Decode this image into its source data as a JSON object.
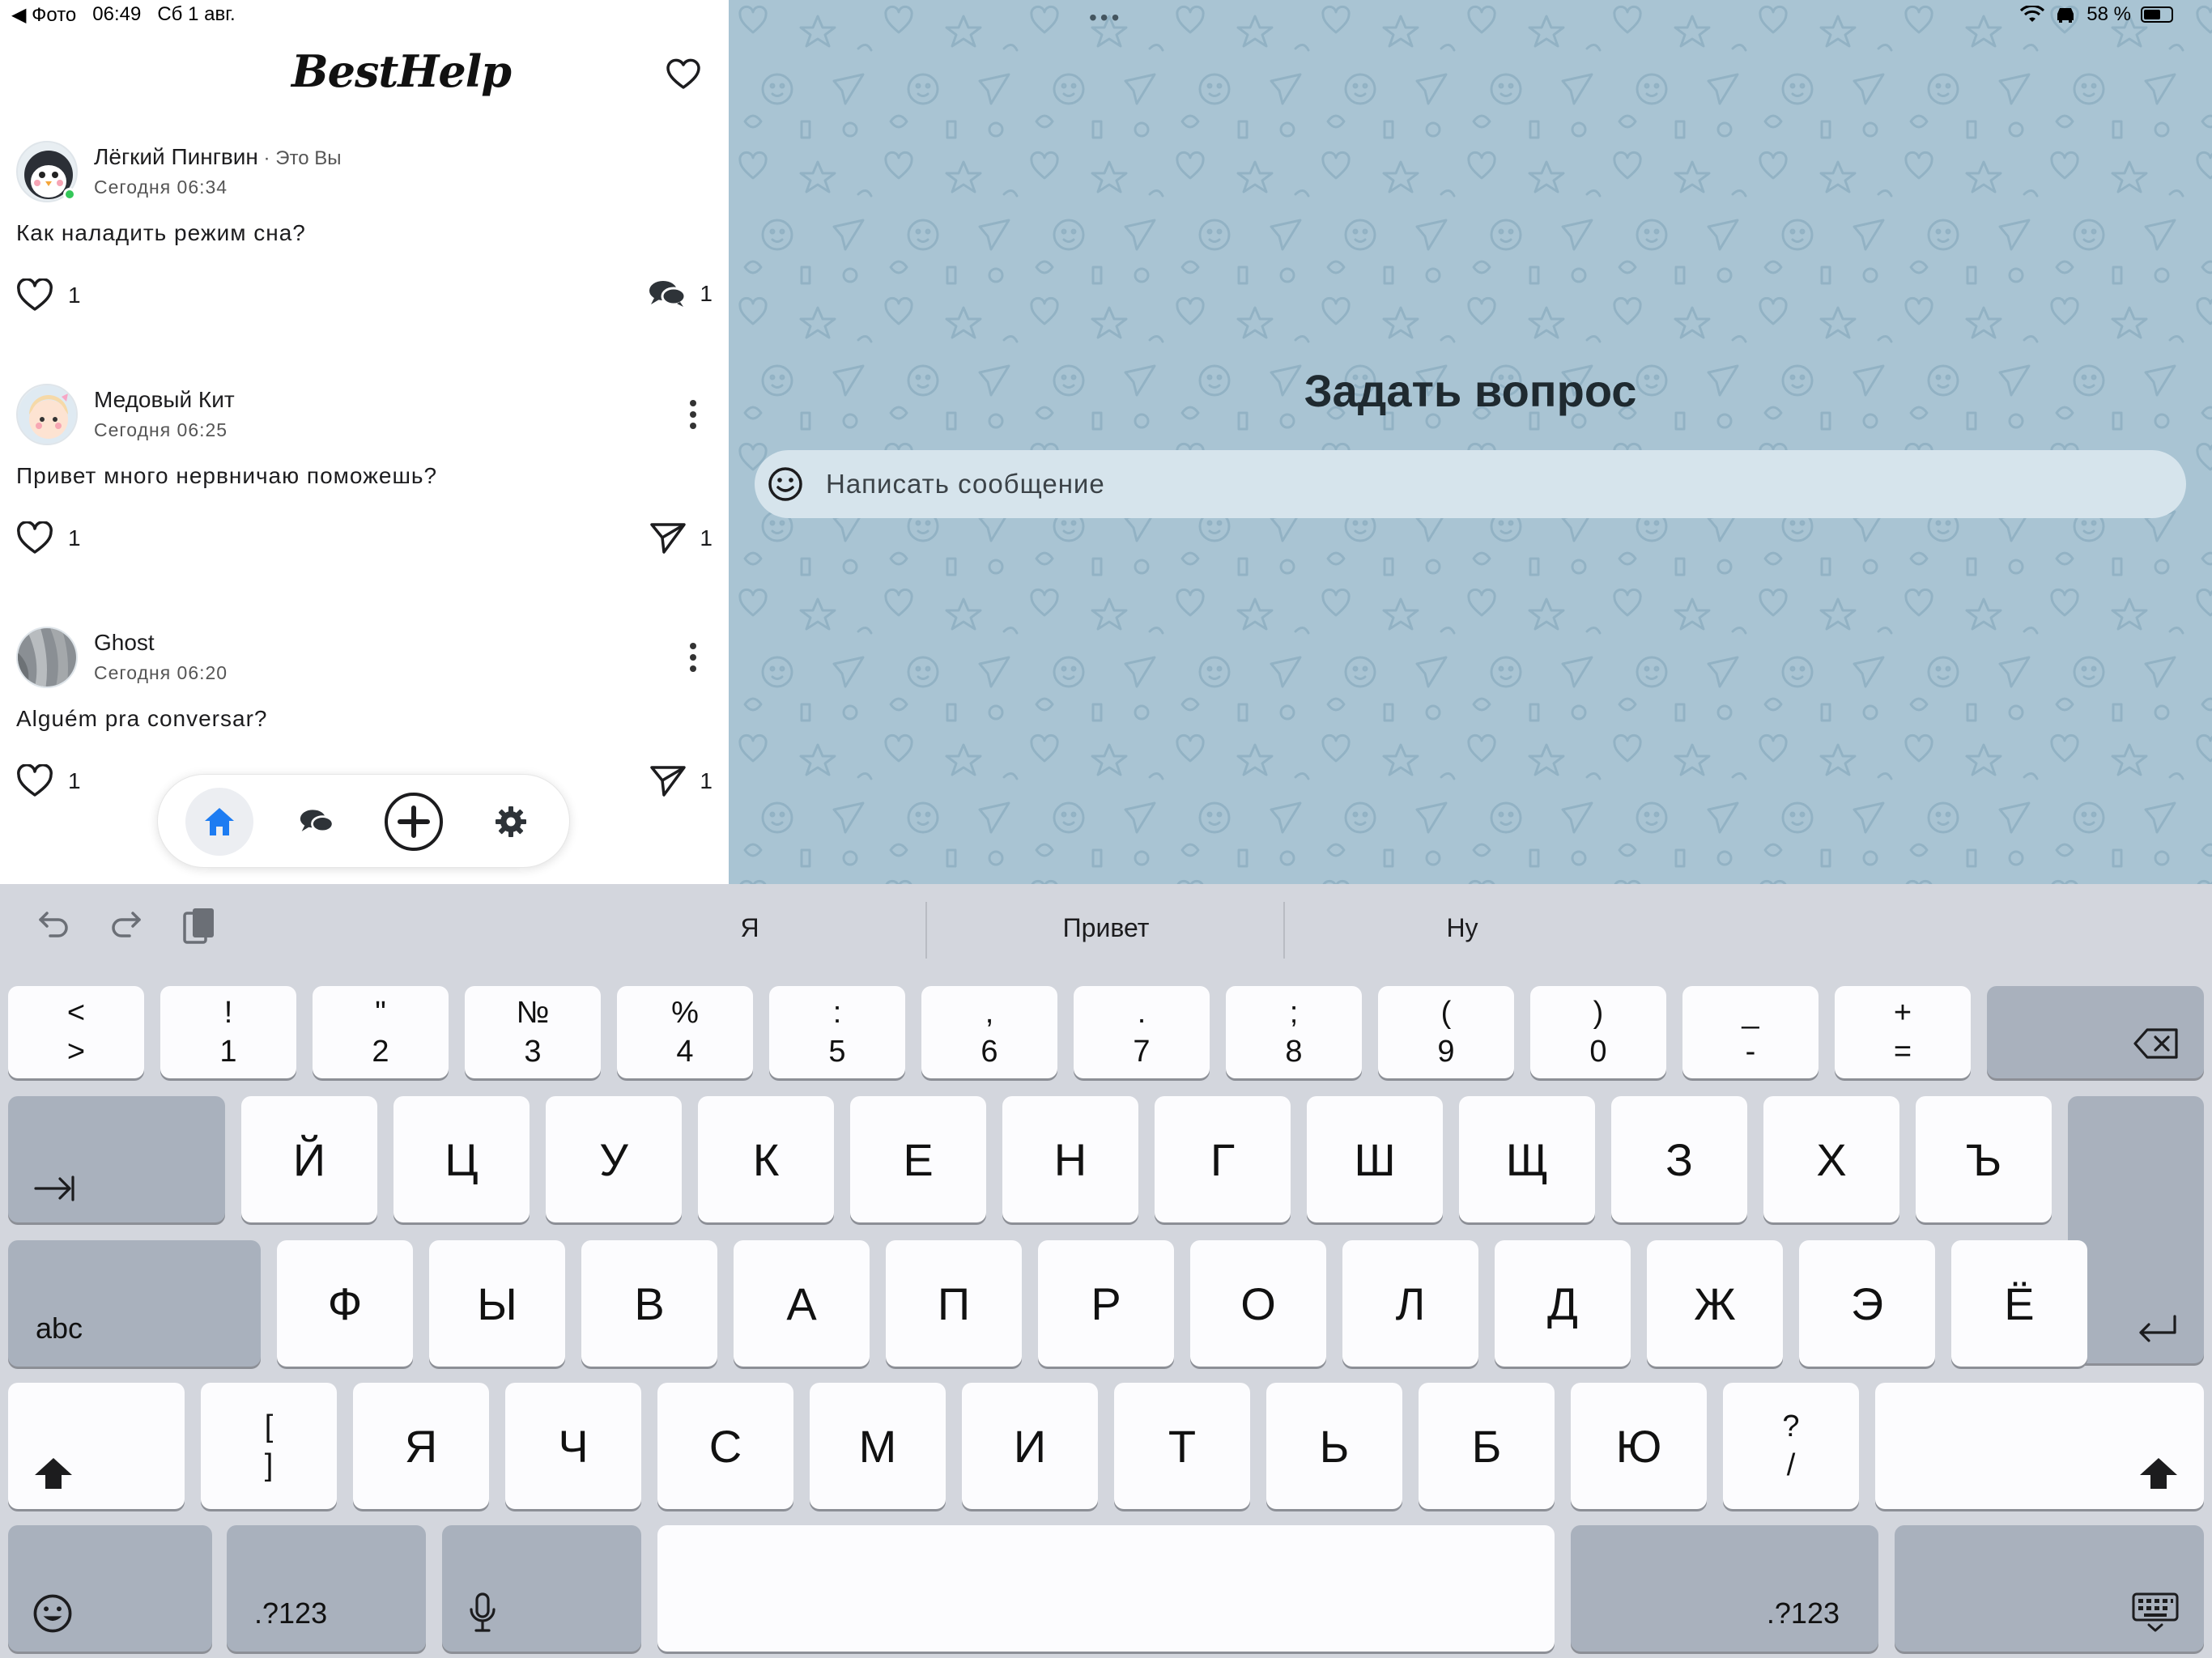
{
  "status_bar": {
    "back_app": "◀ Фото",
    "time": "06:49",
    "date": "Сб 1 авг.",
    "battery": "58 %"
  },
  "app": {
    "brand": "BestHelp"
  },
  "posts": [
    {
      "author": "Лёгкий Пингвин",
      "you_label": " · Это Вы",
      "time": "Сегодня 06:34",
      "text": "Как наладить режим сна?",
      "likes": "1",
      "replies": "1"
    },
    {
      "author": "Медовый Кит",
      "time": "Сегодня 06:25",
      "text": "Привет много нервничаю поможешь?",
      "likes": "1",
      "replies": "1"
    },
    {
      "author": "Ghost",
      "time": "Сегодня 06:20",
      "text": "Alguém pra conversar?",
      "likes": "1",
      "replies": "1"
    }
  ],
  "composer": {
    "title": "Задать вопрос",
    "placeholder": "Написать сообщение"
  },
  "keyboard": {
    "predictions": [
      "Я",
      "Привет",
      "Ну"
    ],
    "row1": [
      {
        "top": "<",
        "bottom": ">"
      },
      {
        "top": "!",
        "bottom": "1"
      },
      {
        "top": "\"",
        "bottom": "2"
      },
      {
        "top": "№",
        "bottom": "3"
      },
      {
        "top": "%",
        "bottom": "4"
      },
      {
        "top": ":",
        "bottom": "5"
      },
      {
        "top": ",",
        "bottom": "6"
      },
      {
        "top": ".",
        "bottom": "7"
      },
      {
        "top": ";",
        "bottom": "8"
      },
      {
        "top": "(",
        "bottom": "9"
      },
      {
        "top": ")",
        "bottom": "0"
      },
      {
        "top": "_",
        "bottom": "-"
      },
      {
        "top": "+",
        "bottom": "="
      }
    ],
    "row2": [
      "Й",
      "Ц",
      "У",
      "К",
      "Е",
      "Н",
      "Г",
      "Ш",
      "Щ",
      "З",
      "Х",
      "Ъ"
    ],
    "row3": [
      "Ф",
      "Ы",
      "В",
      "А",
      "П",
      "Р",
      "О",
      "Л",
      "Д",
      "Ж",
      "Э",
      "Ё"
    ],
    "row4": [
      "Я",
      "Ч",
      "С",
      "М",
      "И",
      "Т",
      "Ь",
      "Б",
      "Ю"
    ],
    "bracket": {
      "top": "[",
      "bottom": "]"
    },
    "question": {
      "top": "?",
      "bottom": "/"
    },
    "abc_label": "abc",
    "numbers_label": ".?123"
  }
}
